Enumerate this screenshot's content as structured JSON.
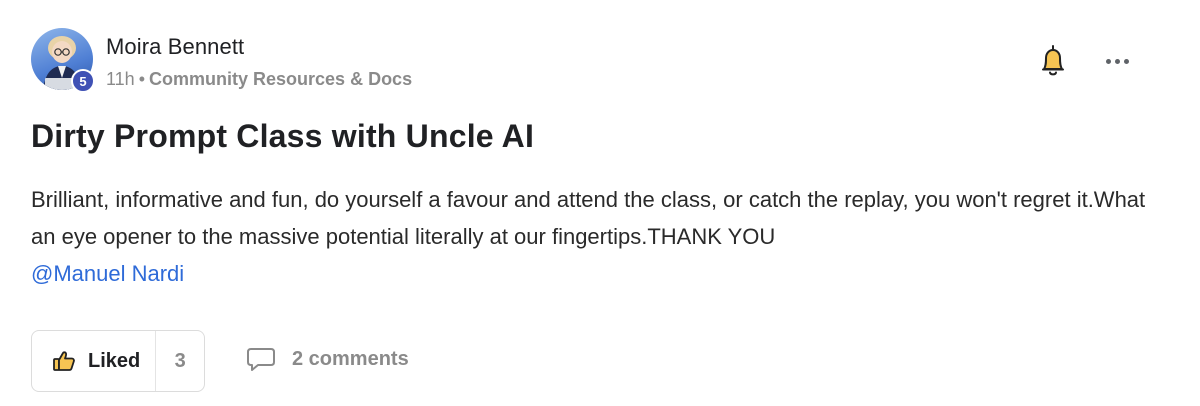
{
  "post": {
    "author": {
      "name": "Moira Bennett",
      "level": "5"
    },
    "meta": {
      "time": "11h",
      "separator": "•",
      "category": "Community Resources & Docs"
    },
    "title": "Dirty Prompt Class with Uncle AI",
    "body_text": "Brilliant, informative and fun, do yourself a favour and attend the class, or catch the replay, you won't regret it.What an eye opener to the massive potential literally at our fingertips.THANK YOU",
    "mention": "@Manuel Nardi",
    "actions": {
      "like_label": "Liked",
      "like_count": "3",
      "comments_label": "2 comments"
    },
    "icons": {
      "bell": "bell-icon",
      "more": "more-horizontal-icon",
      "like": "thumbs-up-icon",
      "comments": "comment-bubble-icon"
    },
    "colors": {
      "bell_fill": "#f6c453",
      "mention": "#2f6bd8",
      "level_badge": "#3f51b5",
      "muted_text": "#8a8a8a"
    }
  }
}
